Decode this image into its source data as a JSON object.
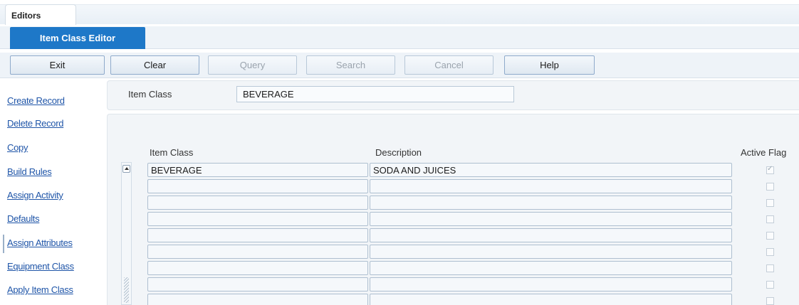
{
  "tabs": {
    "editors": "Editors",
    "active_subtab": "Item Class Editor"
  },
  "toolbar": {
    "exit": "Exit",
    "clear": "Clear",
    "query": "Query",
    "search": "Search",
    "cancel": "Cancel",
    "help": "Help"
  },
  "sidebar": {
    "items": [
      "Create Record",
      "Delete Record",
      "Copy",
      "Build Rules",
      "Assign Activity",
      "Defaults",
      "Assign Attributes",
      "Equipment Class",
      "Apply Item Class"
    ]
  },
  "header": {
    "item_class_label": "Item Class",
    "item_class_value": "BEVERAGE"
  },
  "grid": {
    "columns": {
      "item_class": "Item Class",
      "description": "Description",
      "active_flag": "Active Flag"
    },
    "rows": [
      {
        "item_class": "BEVERAGE",
        "description": "SODA AND JUICES",
        "active": true
      },
      {
        "item_class": "",
        "description": "",
        "active": false
      },
      {
        "item_class": "",
        "description": "",
        "active": false
      },
      {
        "item_class": "",
        "description": "",
        "active": false
      },
      {
        "item_class": "",
        "description": "",
        "active": false
      },
      {
        "item_class": "",
        "description": "",
        "active": false
      },
      {
        "item_class": "",
        "description": "",
        "active": false
      },
      {
        "item_class": "",
        "description": "",
        "active": false
      },
      {
        "item_class": "",
        "description": "",
        "active": false
      }
    ]
  },
  "colors": {
    "accent": "#1e78c8",
    "link": "#1f55a8"
  }
}
